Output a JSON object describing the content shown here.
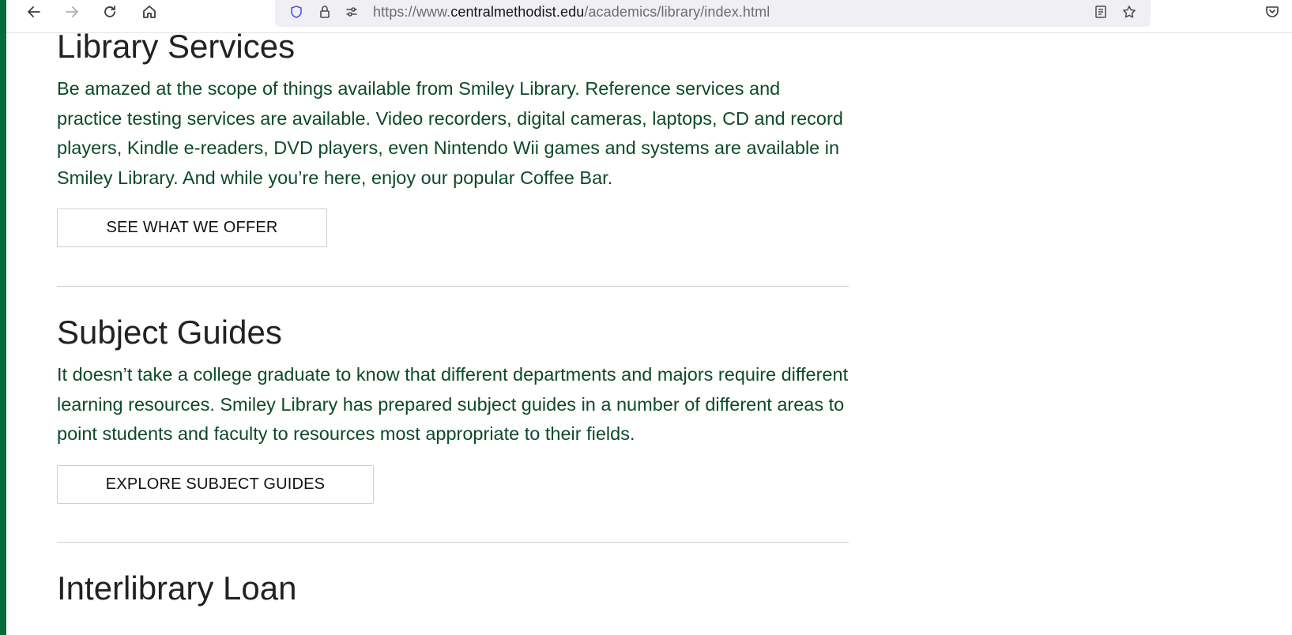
{
  "browser": {
    "url_scheme": "https://www.",
    "url_host": "centralmethodist.edu",
    "url_path": "/academics/library/index.html"
  },
  "sections": [
    {
      "title": "Library Services",
      "body": "Be amazed at the scope of things available from Smiley Library. Reference services and practice testing services are available. Video recorders, digital cameras, laptops, CD and record players, Kindle e-readers, DVD players, even Nintendo Wii games and systems are available in Smiley Library. And while you’re here, enjoy our popular Coffee Bar.",
      "button": "SEE WHAT WE OFFER"
    },
    {
      "title": "Subject Guides",
      "body": "It doesn’t take a college graduate to know that different departments and majors require different learning resources. Smiley Library has prepared subject guides in a number of different areas to point students and faculty to resources most appropriate to their fields.",
      "button": "EXPLORE SUBJECT GUIDES"
    },
    {
      "title": "Interlibrary Loan"
    }
  ],
  "colors": {
    "frame": "#0a6b3a",
    "body_text": "#0d4a2a",
    "heading": "#222222"
  }
}
